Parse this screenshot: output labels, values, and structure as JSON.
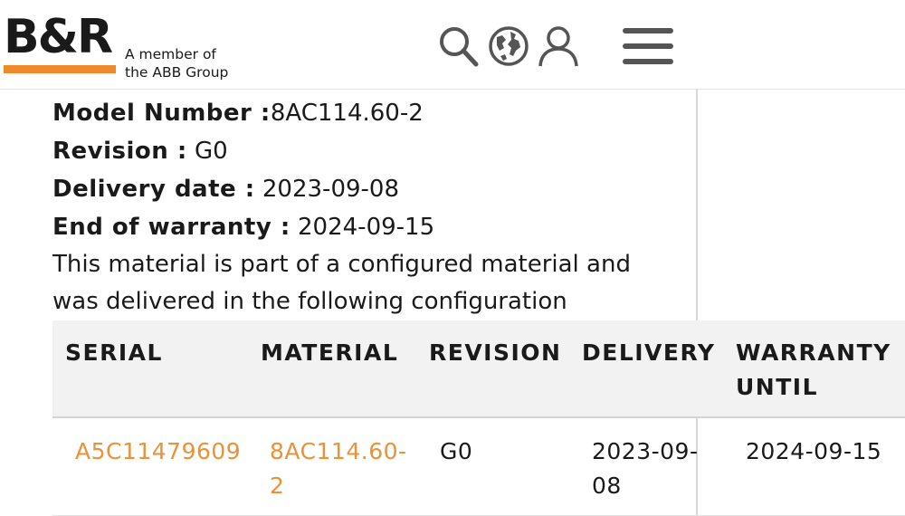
{
  "header": {
    "logo_text": "B&R",
    "logo_member_line1": "A member of",
    "logo_member_line2": "the ABB Group",
    "brand_color": "#f0892a",
    "icons": [
      "search-icon",
      "globe-icon",
      "user-icon",
      "hamburger-menu-icon"
    ]
  },
  "product": {
    "model_label": "Model Number :",
    "model_value": "8AC114.60-2",
    "revision_label": "Revision :",
    "revision_value": "G0",
    "delivery_label": "Delivery date :",
    "delivery_value": "2023-09-08",
    "warranty_label": "End of warranty :",
    "warranty_value": "2024-09-15",
    "config_text": "This material is part of a configured material and was delivered in the following configuration"
  },
  "table": {
    "headers": {
      "serial": "SERIAL",
      "material": "MATERIAL",
      "revision": "REVISION",
      "delivery": "DELIVERY",
      "warranty_line1": "WARRANTY",
      "warranty_line2": "UNTIL"
    },
    "rows": [
      {
        "serial": "A5C11479609",
        "material_line1": "8AC114.60-",
        "material_line2": "2",
        "revision": "G0",
        "delivery_line1": "2023-09-",
        "delivery_line2": "08",
        "warranty": "2024-09-15"
      }
    ],
    "link_color": "#e8923a"
  }
}
